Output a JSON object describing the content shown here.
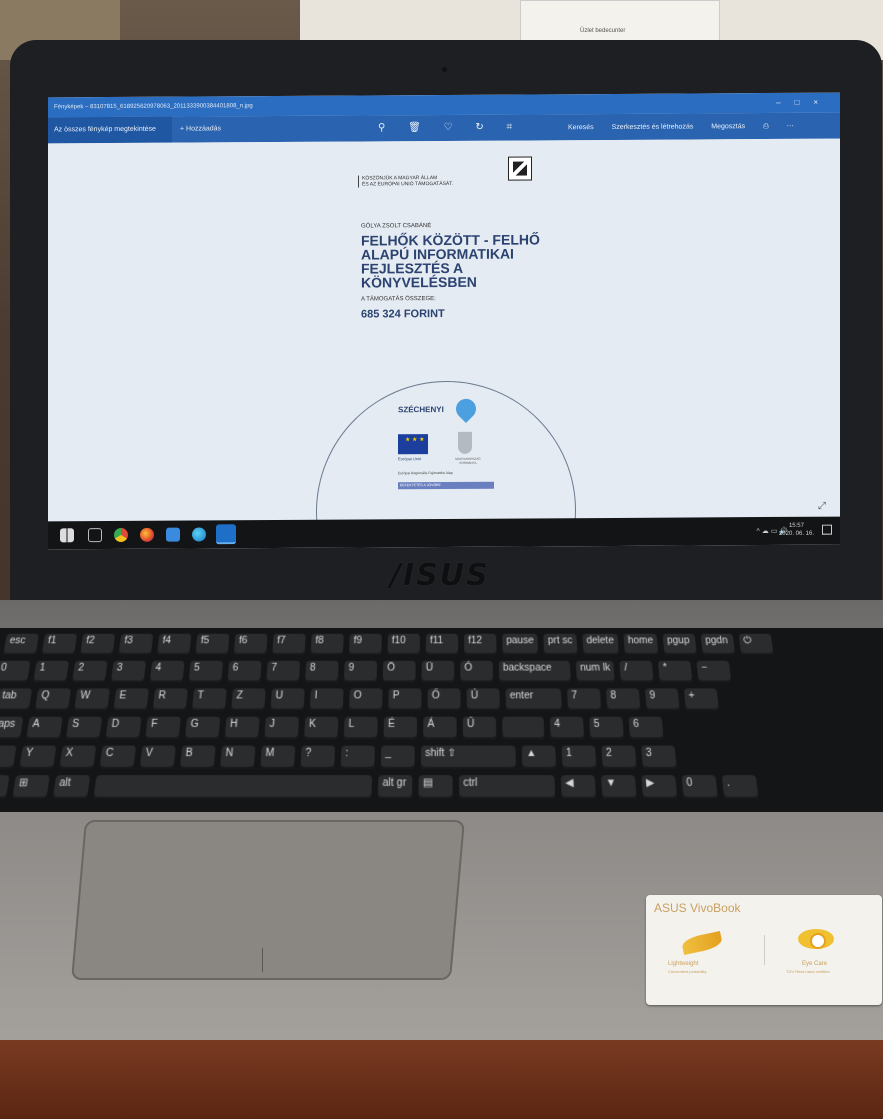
{
  "photos_app": {
    "window_title": "Fényképek – 83107815_618925620978063_2011333900384401808_n.jpg",
    "toolbar": {
      "see_all": "Az összes fénykép megtekintése",
      "add": "+ Hozzáadás",
      "search": "Keresés",
      "edit_create": "Szerkesztés és létrehozás",
      "share": "Megosztás"
    }
  },
  "document": {
    "thanks_line1": "KÖSZÖNJÜK A MAGYAR ÁLLAM",
    "thanks_line2": "ÉS AZ EURÓPAI UNIÓ TÁMOGATÁSÁT.",
    "beneficiary": "GÓLYA ZSOLT CSABÁNÉ",
    "project_title": "FELHŐK KÖZÖTT - FELHŐ ALAPÚ INFORMATIKAI FEJLESZTÉS A KÖNYVELÉSBEN",
    "support_label": "A TÁMOGATÁS ÖSSZEGE:",
    "support_amount": "685 324 FORINT",
    "program": "SZÉCHENYI",
    "eu_label": "Európai Unió",
    "hu_label": "MAGYARORSZÁG KORMÁNYA",
    "fund_line1": "Európai Regionális Fejlesztési Alap",
    "fund_line2": "BEFEKTETÉS A JÖVŐBE"
  },
  "taskbar": {
    "time": "15:57",
    "date": "2020. 06. 16."
  },
  "laptop": {
    "brand": "/ISUS",
    "sticker_brand": "ASUS VivoBook",
    "sticker_left": "Lightweight",
    "sticker_left_sub": "Convenient portability",
    "sticker_right": "Eye Care",
    "sticker_right_sub": "TÜV Rhein-land certified"
  },
  "paper_label": "Üzlet bedecunter"
}
